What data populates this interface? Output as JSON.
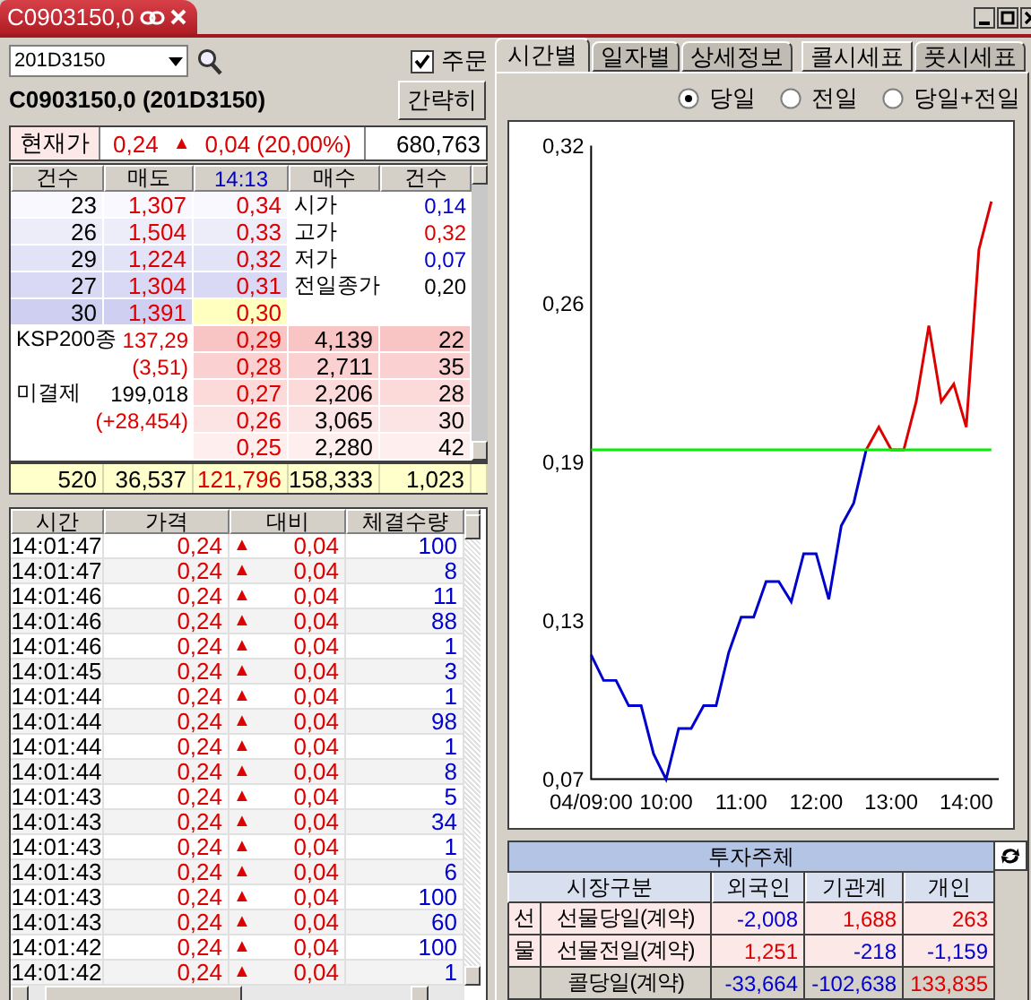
{
  "document_tab": {
    "title": "C0903150,0"
  },
  "code_field": {
    "value": "201D3150"
  },
  "order_checkbox": {
    "label": "주문",
    "checked": true
  },
  "symbol_title": "C0903150,0 (201D3150)",
  "brief_button": {
    "label": "간략히"
  },
  "current": {
    "label": "현재가",
    "price": "0,24",
    "arrow": "▲",
    "change": "0,04 (20,00%)",
    "volume": "680,763"
  },
  "orderbook": {
    "columns": [
      "건수",
      "매도",
      "14:13",
      "매수",
      "건수"
    ],
    "asks": [
      {
        "count": "23",
        "qty": "1,307",
        "price": "0,34",
        "highlighted": false
      },
      {
        "count": "26",
        "qty": "1,504",
        "price": "0,33",
        "highlighted": false
      },
      {
        "count": "29",
        "qty": "1,224",
        "price": "0,32",
        "highlighted": false
      },
      {
        "count": "27",
        "qty": "1,304",
        "price": "0,31",
        "highlighted": false
      },
      {
        "count": "30",
        "qty": "1,391",
        "price": "0,30",
        "highlighted": true
      }
    ],
    "info": [
      {
        "label": "시가",
        "value": "0,14",
        "color": "#0000cc"
      },
      {
        "label": "고가",
        "value": "0,32",
        "color": "#dd0000"
      },
      {
        "label": "저가",
        "value": "0,07",
        "color": "#0000cc"
      },
      {
        "label": "전일종가",
        "value": "0,20",
        "color": "#000000"
      }
    ],
    "bids": [
      {
        "price": "0,29",
        "qty": "4,139",
        "count": "22"
      },
      {
        "price": "0,28",
        "qty": "2,711",
        "count": "35"
      },
      {
        "price": "0,27",
        "qty": "2,206",
        "count": "28"
      },
      {
        "price": "0,26",
        "qty": "3,065",
        "count": "30"
      },
      {
        "price": "0,25",
        "qty": "2,280",
        "count": "42"
      }
    ],
    "market": [
      {
        "label": "KSP200종",
        "value": "137,29",
        "color": "#dd0000",
        "sub": "(3,51)"
      },
      {
        "label": "미결제",
        "value": "199,018",
        "color": "#000000",
        "sub": "(+28,454)"
      }
    ],
    "totals": [
      "520",
      "36,537",
      "121,796",
      "158,333",
      "1,023"
    ]
  },
  "trades": {
    "columns": [
      "시간",
      "가격",
      "대비",
      "체결수량"
    ],
    "rows": [
      {
        "time": "14:01:47",
        "price": "0,24",
        "arrow": "▲",
        "change": "0,04",
        "qty": "100"
      },
      {
        "time": "14:01:47",
        "price": "0,24",
        "arrow": "▲",
        "change": "0,04",
        "qty": "8"
      },
      {
        "time": "14:01:46",
        "price": "0,24",
        "arrow": "▲",
        "change": "0,04",
        "qty": "11"
      },
      {
        "time": "14:01:46",
        "price": "0,24",
        "arrow": "▲",
        "change": "0,04",
        "qty": "88"
      },
      {
        "time": "14:01:46",
        "price": "0,24",
        "arrow": "▲",
        "change": "0,04",
        "qty": "1"
      },
      {
        "time": "14:01:45",
        "price": "0,24",
        "arrow": "▲",
        "change": "0,04",
        "qty": "3"
      },
      {
        "time": "14:01:44",
        "price": "0,24",
        "arrow": "▲",
        "change": "0,04",
        "qty": "1"
      },
      {
        "time": "14:01:44",
        "price": "0,24",
        "arrow": "▲",
        "change": "0,04",
        "qty": "98"
      },
      {
        "time": "14:01:44",
        "price": "0,24",
        "arrow": "▲",
        "change": "0,04",
        "qty": "1"
      },
      {
        "time": "14:01:44",
        "price": "0,24",
        "arrow": "▲",
        "change": "0,04",
        "qty": "8"
      },
      {
        "time": "14:01:43",
        "price": "0,24",
        "arrow": "▲",
        "change": "0,04",
        "qty": "5"
      },
      {
        "time": "14:01:43",
        "price": "0,24",
        "arrow": "▲",
        "change": "0,04",
        "qty": "34"
      },
      {
        "time": "14:01:43",
        "price": "0,24",
        "arrow": "▲",
        "change": "0,04",
        "qty": "1"
      },
      {
        "time": "14:01:43",
        "price": "0,24",
        "arrow": "▲",
        "change": "0,04",
        "qty": "6"
      },
      {
        "time": "14:01:43",
        "price": "0,24",
        "arrow": "▲",
        "change": "0,04",
        "qty": "100"
      },
      {
        "time": "14:01:43",
        "price": "0,24",
        "arrow": "▲",
        "change": "0,04",
        "qty": "60"
      },
      {
        "time": "14:01:42",
        "price": "0,24",
        "arrow": "▲",
        "change": "0,04",
        "qty": "100"
      },
      {
        "time": "14:01:42",
        "price": "0,24",
        "arrow": "▲",
        "change": "0,04",
        "qty": "1"
      }
    ]
  },
  "tabs": [
    {
      "label": "시간별",
      "selected": true
    },
    {
      "label": "일자별",
      "selected": false
    },
    {
      "label": "상세정보",
      "selected": false
    },
    {
      "label": "콜시세표",
      "selected": false
    },
    {
      "label": "풋시세표",
      "selected": false
    }
  ],
  "period_options": [
    {
      "label": "당일",
      "selected": true
    },
    {
      "label": "전일",
      "selected": false
    },
    {
      "label": "당일+전일",
      "selected": false
    }
  ],
  "chart_data": {
    "type": "line",
    "categories": [
      "04/09:00",
      null,
      null,
      null,
      null,
      null,
      "10:00",
      null,
      null,
      null,
      null,
      null,
      "11:00",
      null,
      null,
      null,
      null,
      null,
      "12:00",
      null,
      null,
      null,
      null,
      null,
      "13:00",
      null,
      null,
      null,
      null,
      null,
      "14:00",
      null,
      null
    ],
    "series": [
      {
        "color": "#0000cc",
        "values": [
          0.119,
          0.109,
          0.109,
          0.099,
          0.099,
          0.08,
          0.07,
          0.09,
          0.09,
          0.099,
          0.099,
          0.12,
          0.134,
          0.134,
          0.148,
          0.148,
          0.14,
          0.159,
          0.159,
          0.141,
          0.17,
          0.179,
          0.2,
          null,
          null,
          null,
          null,
          null,
          null,
          null,
          null,
          null,
          null
        ]
      },
      {
        "color": "#dd0000",
        "values": [
          null,
          null,
          null,
          null,
          null,
          null,
          null,
          null,
          null,
          null,
          null,
          null,
          null,
          null,
          null,
          null,
          null,
          null,
          null,
          null,
          null,
          null,
          0.2,
          0.209,
          0.2,
          0.2,
          0.219,
          0.249,
          0.219,
          0.226,
          0.209,
          0.279,
          0.298
        ]
      },
      {
        "color": "#00ee00",
        "values": [
          0.2,
          0.2,
          0.2,
          0.2,
          0.2,
          0.2,
          0.2,
          0.2,
          0.2,
          0.2,
          0.2,
          0.2,
          0.2,
          0.2,
          0.2,
          0.2,
          0.2,
          0.2,
          0.2,
          0.2,
          0.2,
          0.2,
          0.2,
          0.2,
          0.2,
          0.2,
          0.2,
          0.2,
          0.2,
          0.2,
          0.2,
          0.2,
          0.2
        ]
      }
    ],
    "ylim": [
      0.07,
      0.32
    ],
    "yticks": [
      {
        "value": 0.07,
        "label": "0,07"
      },
      {
        "value": 0.1325,
        "label": "0,13"
      },
      {
        "value": 0.195,
        "label": "0,19"
      },
      {
        "value": 0.2575,
        "label": "0,26"
      },
      {
        "value": 0.32,
        "label": "0,32"
      }
    ]
  },
  "investors": {
    "title": "투자주체",
    "columns": [
      "시장구분",
      "외국인",
      "기관계",
      "개인"
    ],
    "rows": [
      {
        "group": "선",
        "label": "선물당일(계약)",
        "values": [
          {
            "value": "-2,008",
            "color": "#0000cc"
          },
          {
            "value": "1,688",
            "color": "#dd0000"
          },
          {
            "value": "263",
            "color": "#dd0000"
          }
        ]
      },
      {
        "group": "물",
        "label": "선물전일(계약)",
        "values": [
          {
            "value": "1,251",
            "color": "#dd0000"
          },
          {
            "value": "-218",
            "color": "#0000cc"
          },
          {
            "value": "-1,159",
            "color": "#0000cc"
          }
        ]
      },
      {
        "label": "콜당일(계약)",
        "values": [
          {
            "value": "-33,664",
            "color": "#0000cc"
          },
          {
            "value": "-102,638",
            "color": "#0000cc"
          },
          {
            "value": "133,835",
            "color": "#dd0000"
          }
        ]
      }
    ]
  }
}
